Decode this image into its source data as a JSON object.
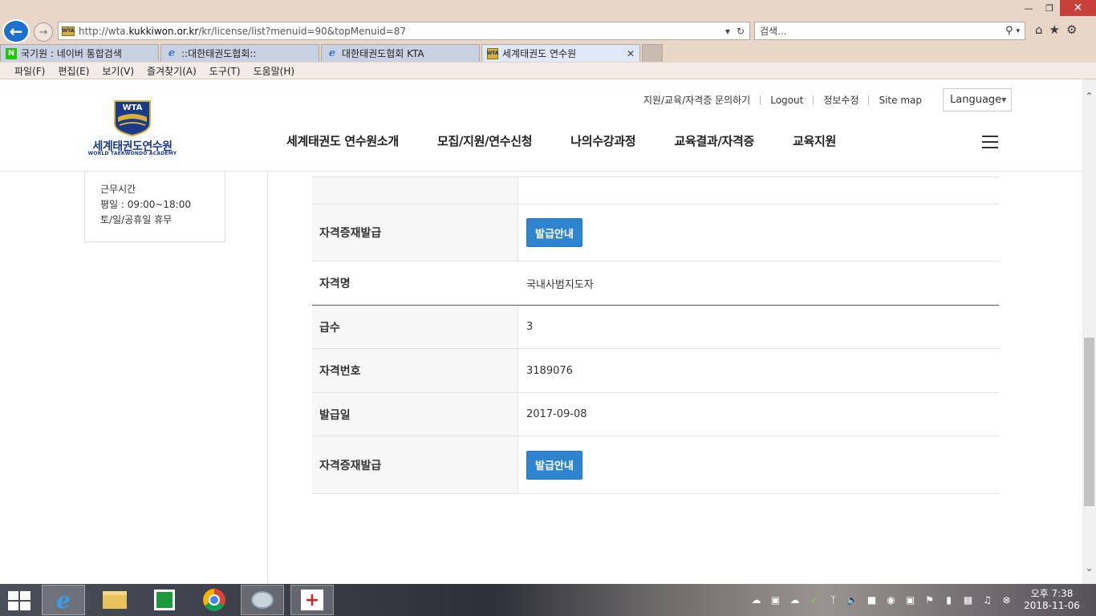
{
  "browser": {
    "url_prefix": "http://wta.",
    "url_domain": "kukkiwon.or.kr",
    "url_path": "/kr/license/list?menuid=90&topMenuid=87",
    "search_placeholder": "검색...",
    "tabs": [
      {
        "label": "국기원 : 네이버 통합검색",
        "icon": "naver-icon"
      },
      {
        "label": "::대한태권도협회::",
        "icon": "ie-icon"
      },
      {
        "label": "대한태권도협회 KTA",
        "icon": "ie-icon"
      },
      {
        "label": "세계태권도 연수원",
        "icon": "wta-icon",
        "active": true
      }
    ],
    "menu": [
      "파일(F)",
      "편집(E)",
      "보기(V)",
      "즐겨찾기(A)",
      "도구(T)",
      "도움말(H)"
    ]
  },
  "site": {
    "logo_badge": "WTA",
    "logo_title": "세계태권도연수원",
    "logo_subtitle": "WORLD TAEKWONDO ACADEMY",
    "util_links": [
      "지원/교육/자격증 문의하기",
      "Logout",
      "정보수정",
      "Site map"
    ],
    "language_label": "Language",
    "gnb": [
      "세계태권도 연수원소개",
      "모집/지원/연수신청",
      "나의수강과정",
      "교육결과/자격증",
      "교육지원"
    ]
  },
  "sidebar": {
    "hours_title": "근무시간",
    "weekday": "평일 : 09:00~18:00",
    "holiday": "토/일/공휴일 휴무"
  },
  "license": {
    "reissue_label": "자격증재발급",
    "reissue_button": "발급안내",
    "name_label": "자격명",
    "name_value": "국내사범지도자",
    "grade_label": "급수",
    "grade_value": "3",
    "number_label": "자격번호",
    "number_value": "3189076",
    "date_label": "발급일",
    "date_value": "2017-09-08"
  },
  "taskbar": {
    "clock_ampm_time": "오후 7:38",
    "clock_date": "2018-11-06"
  },
  "colors": {
    "accent_button": "#2f84d0",
    "brand_blue": "#1a3a8a",
    "brand_gold": "#d6b23a"
  }
}
